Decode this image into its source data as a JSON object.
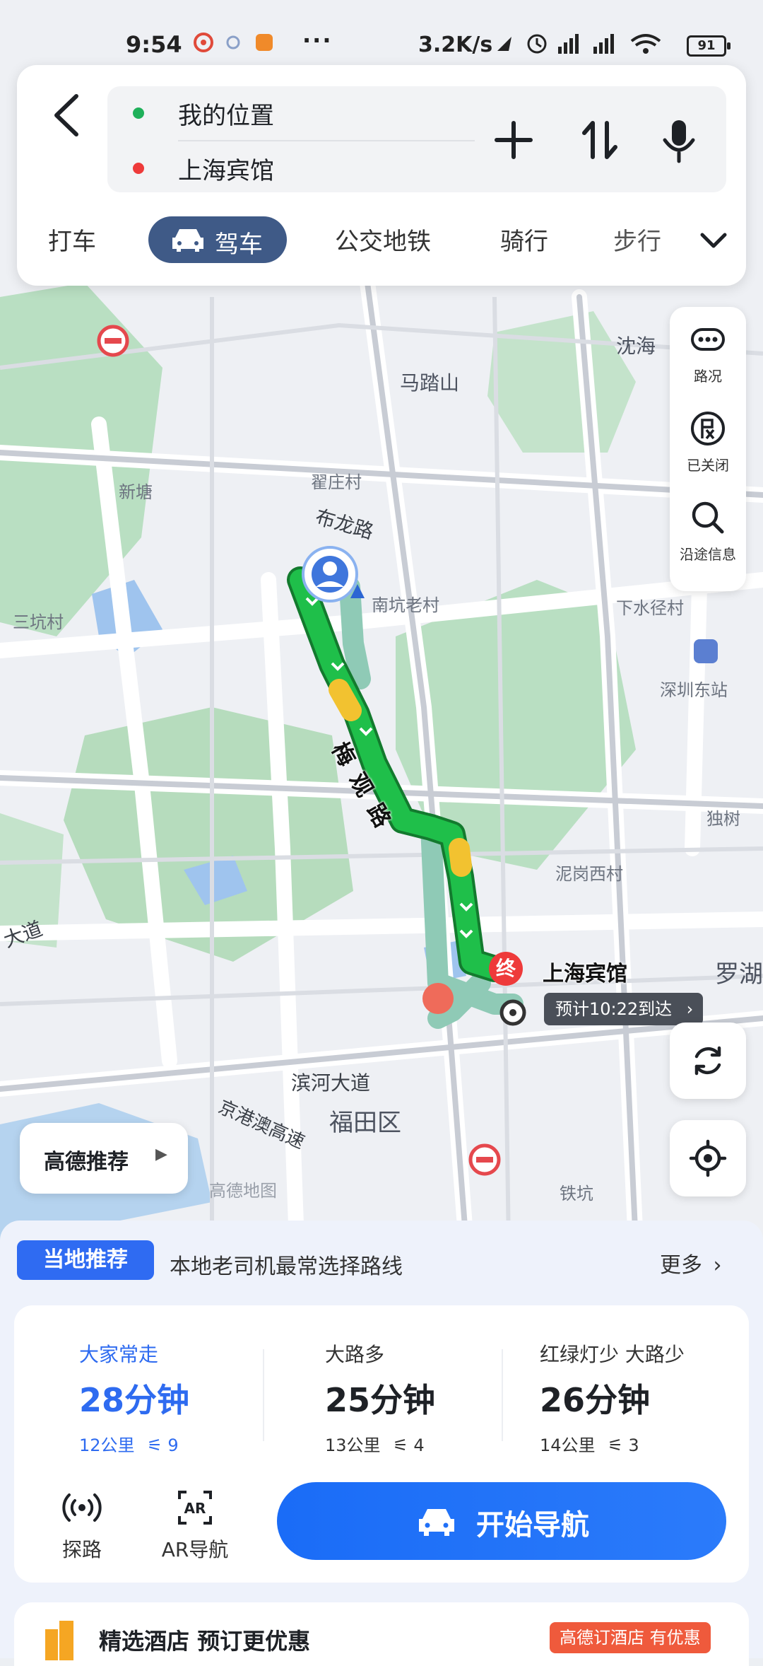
{
  "status_bar": {
    "time": "9:54",
    "dots": "···",
    "net_speed": "3.2K/s",
    "battery": "91"
  },
  "route": {
    "origin": "我的位置",
    "destination": "上海宾馆",
    "origin_color": "#1fb05a",
    "destination_color": "#ee3a3a"
  },
  "tabs": [
    {
      "label": "打车"
    },
    {
      "label": "驾车",
      "active": true
    },
    {
      "label": "公交地铁"
    },
    {
      "label": "骑行"
    },
    {
      "label": "步行"
    }
  ],
  "side_panel": {
    "traffic": "路况",
    "restriction": "已关闭",
    "along_info": "沿途信息"
  },
  "map": {
    "labels": {
      "shen_hai": "沈海",
      "ma_lu_shan": "马踏山",
      "zhai_zhuang": "翟庄村",
      "bu_long_lu": "布龙路",
      "xin_tang": "新塘",
      "nan_keng": "南坑老村",
      "san_keng": "三坑村",
      "xia_shui_jing": "下水径村",
      "shenzhen_east": "深圳东站",
      "du_shu": "独树",
      "ni_gang_xi": "泥岗西村",
      "da_dao": "大道",
      "luo_hu": "罗湖",
      "bin_he": "滨河大道",
      "futian": "福田区",
      "jing_gang_ao": "京港澳高速",
      "tie_keng": "铁坑",
      "gaode_logo": "高德地图"
    },
    "road_meiguan": "梅观路",
    "dest_marker": "终",
    "eta": "预计10:22到达",
    "route_color": "#1fbf4a",
    "alt_route_color": "#8fcab6"
  },
  "gaode_recommend": "高德推荐",
  "bottom": {
    "local_tag": "当地推荐",
    "local_desc": "本地老司机最常选择路线",
    "more": "更多",
    "options": [
      {
        "tag": "大家常走",
        "duration": "28分钟",
        "distance": "12公里",
        "lights": "9"
      },
      {
        "tag": "大路多",
        "duration": "25分钟",
        "distance": "13公里",
        "lights": "4"
      },
      {
        "tag": "红绿灯少 大路少",
        "duration": "26分钟",
        "distance": "14公里",
        "lights": "3"
      }
    ],
    "explore": "探路",
    "ar_nav": "AR导航",
    "start_nav": "开始导航",
    "hotel_title": "精选酒店 预订更优惠",
    "hotel_badge": "高德订酒店 有优惠"
  }
}
